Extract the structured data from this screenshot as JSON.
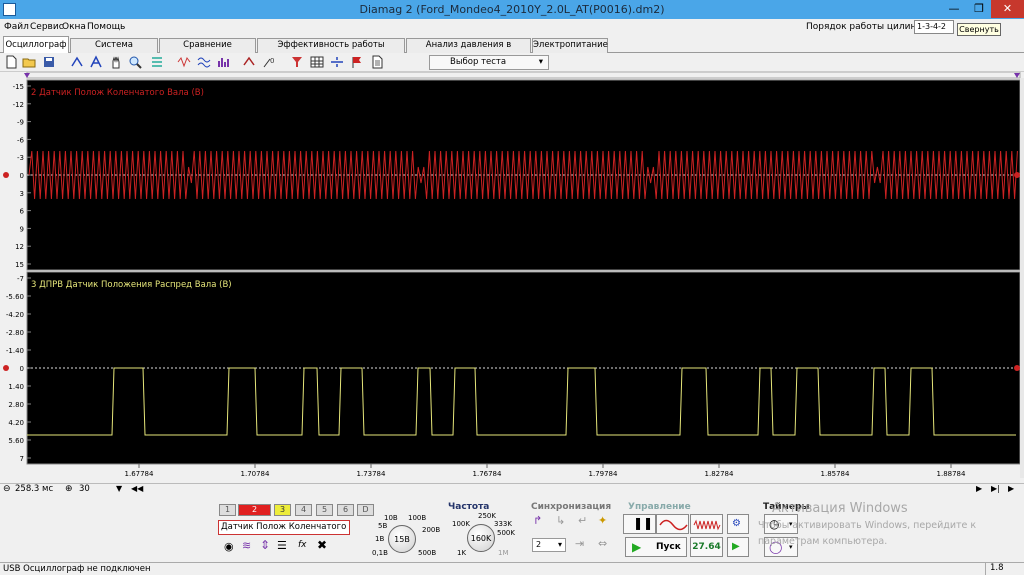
{
  "window": {
    "title": "Diamag 2 (Ford_Mondeo4_2010Y_2.0L_AT(P0016).dm2)"
  },
  "menu": [
    "Файл",
    "Сервис",
    "Окна",
    "Помощь"
  ],
  "cylinder_order": {
    "label": "Порядок работы цилиндров",
    "value": "1-3-4-2",
    "tooltip": "Свернуть"
  },
  "tabs": [
    "Осциллограф",
    "Система зажигания",
    "Сравнение цилиндров",
    "Эффективность работы цилиндров",
    "Анализ давления в цилиндре",
    "Электропитание"
  ],
  "toolbar": {
    "test_selector": "Выбор теста"
  },
  "channels": [
    {
      "name": "2 Датчик Полож Коленчатого Вала (В)",
      "color": "#cc2222",
      "y_ticks": [
        "-15",
        "-12",
        "-9",
        "-6",
        "-3",
        "0",
        "3",
        "6",
        "9",
        "12",
        "15"
      ]
    },
    {
      "name": "3 ДПРВ Датчик Положения Распред Вала (В)",
      "color": "#e6e67a",
      "y_ticks": [
        "-7",
        "-5.60",
        "-4.20",
        "-2.80",
        "-1.40",
        "0",
        "1.40",
        "2.80",
        "4.20",
        "5.60",
        "7"
      ]
    }
  ],
  "x_ticks": [
    "1.67784",
    "1.70784",
    "1.73784",
    "1.76784",
    "1.79784",
    "1.82784",
    "1.85784",
    "1.88784"
  ],
  "timebase": {
    "value": "258.3 мс",
    "count": "30"
  },
  "channel_buttons": [
    "1",
    "2",
    "3",
    "4",
    "5",
    "6",
    "D"
  ],
  "active_channel": "Датчик Полож Коленчатого Ва",
  "voltage_knob": {
    "labels": [
      "10В",
      "100В",
      "5В",
      "200В",
      "1В",
      "0,1В",
      "500В"
    ],
    "value": "15В"
  },
  "freq": {
    "title": "Частота",
    "labels": [
      "250K",
      "100K",
      "333K",
      "500K",
      "1K",
      "1M"
    ],
    "value": "160K"
  },
  "sync": {
    "title": "Синхронизация",
    "value": "2"
  },
  "control": {
    "title": "Управление",
    "start": "Пуск",
    "value": "27.64"
  },
  "timers": {
    "title": "Таймеры"
  },
  "status": {
    "left": "USB Осциллограф не подключен",
    "right": "1.8"
  },
  "activation": {
    "line1": "Активация Windows",
    "line2": "Чтобы активировать Windows, перейдите к",
    "line3": "параметрам компьютера."
  }
}
